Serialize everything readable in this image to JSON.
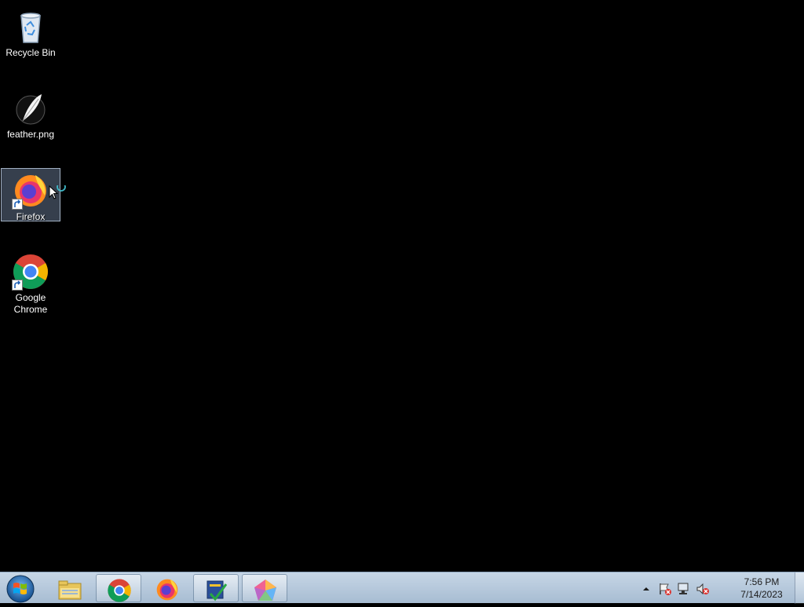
{
  "desktop": {
    "icons": [
      {
        "label": "Recycle Bin",
        "icon": "recycle-bin-icon"
      },
      {
        "label": "feather.png",
        "icon": "feather-image-icon"
      },
      {
        "label": "Firefox",
        "icon": "firefox-icon",
        "selected": true
      },
      {
        "label": "Google Chrome",
        "icon": "chrome-icon"
      }
    ]
  },
  "taskbar": {
    "start": {
      "icon": "windows-start-orb-icon"
    },
    "pinned": [
      {
        "name": "Windows Explorer",
        "icon": "folder-icon"
      },
      {
        "name": "Google Chrome",
        "icon": "chrome-icon",
        "active": true
      },
      {
        "name": "Firefox",
        "icon": "firefox-icon"
      },
      {
        "name": "Task app",
        "icon": "checklist-icon",
        "active": true
      },
      {
        "name": "Color app",
        "icon": "colorful-pentagon-icon",
        "active": true
      }
    ],
    "tray": {
      "icons": [
        "show-hidden-icons-arrow-icon",
        "action-center-flag-icon",
        "network-icon",
        "volume-muted-icon"
      ],
      "time": "7:56 PM",
      "date": "7/14/2023"
    }
  }
}
